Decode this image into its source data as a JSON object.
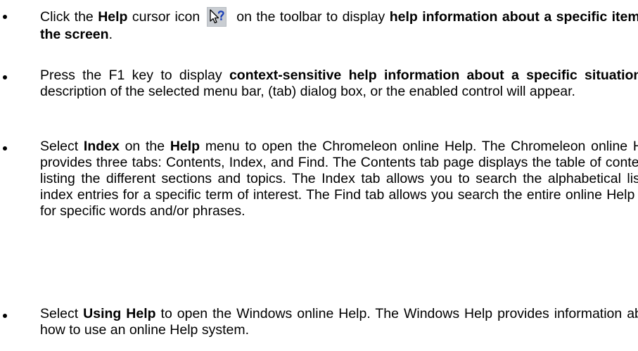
{
  "bullets": [
    {
      "t1": "Click the ",
      "b1": "Help",
      "t2": " cursor icon",
      "t3": "on the toolbar to display ",
      "b2": "help information about a specific item on the screen",
      "t4": "."
    },
    {
      "t1": "Press the F1 key to display ",
      "b1": "context-sensitive help information about a specific situation",
      "t2": ". A description of the selected menu bar, (tab) dialog box, or the enabled control will appear."
    },
    {
      "t1": "Select ",
      "b1": "Index",
      "t2": " on the ",
      "b2": "Help",
      "t3": " menu to open the Chromeleon online Help. The Chromeleon online Help provides three tabs: Contents, Index, and Find. The Contents tab page displays the table of contents, listing the different sections and topics. The Index tab allows you to search the alphabetical list of index entries for a specific term of interest. The Find tab allows you search the entire online Help text for specific words and/or phrases."
    },
    {
      "t1": "Select ",
      "b1": "Using Help",
      "t2": " to open the Windows online Help. The Windows Help provides information about how to use an online Help system."
    }
  ],
  "icons": {
    "help_cursor": "help-cursor-icon"
  }
}
